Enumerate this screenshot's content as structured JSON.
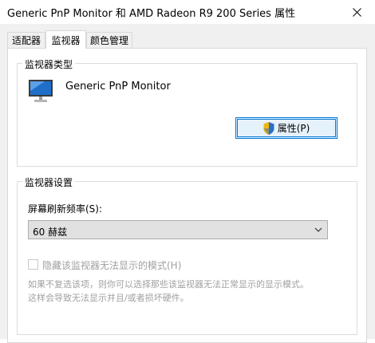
{
  "window": {
    "title": "Generic PnP Monitor 和 AMD Radeon R9 200 Series 属性",
    "close_icon": "close-icon"
  },
  "tabs": [
    {
      "label": "适配器",
      "active": false
    },
    {
      "label": "监视器",
      "active": true
    },
    {
      "label": "颜色管理",
      "active": false
    }
  ],
  "monitor_type": {
    "legend": "监视器类型",
    "monitor_name": "Generic PnP Monitor",
    "icon": "monitor-icon",
    "properties_button": {
      "label": "属性(P)",
      "icon": "uac-shield-icon"
    }
  },
  "monitor_settings": {
    "legend": "监视器设置",
    "refresh_rate_label": "屏幕刷新频率(S):",
    "refresh_rate_value": "60 赫兹",
    "hide_modes_checkbox": {
      "label": "隐藏该监视器无法显示的模式(H)",
      "checked": false,
      "enabled": false
    },
    "description_line1": "如果不复选该项，则你可以选择那些该监视器无法正常显示的显示模式。",
    "description_line2": "这样会导致无法显示并且/或者损坏硬件。"
  },
  "colors": {
    "accent": "#0078d7",
    "button_bg": "#e5f1fb",
    "disabled_text": "#a0a0a0"
  }
}
